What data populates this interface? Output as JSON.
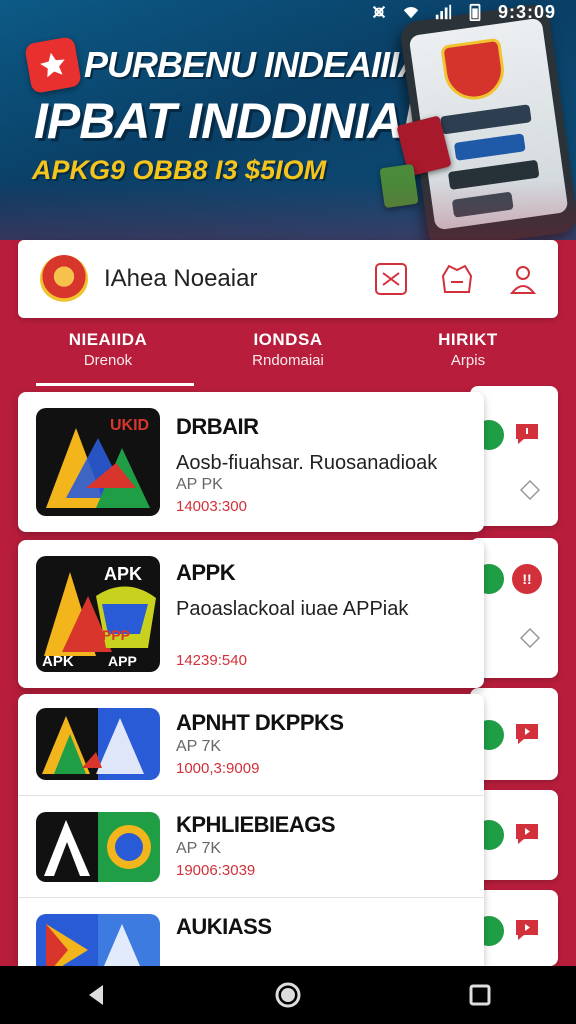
{
  "status_bar": {
    "time": "9:3:09"
  },
  "banner": {
    "title": "PURBENU INDEAIIIA",
    "subtitle": "IPBAT INDDINIAN",
    "tagline": "APKG9 OBB8 I3 $5IOM"
  },
  "header": {
    "title": "IAhea Noeaiar"
  },
  "tabs": [
    {
      "label": "NIEAIIDA",
      "sub": "Drenok"
    },
    {
      "label": "IONDSA",
      "sub": "Rndomaiai"
    },
    {
      "label": "HIRIKT",
      "sub": "Arpis"
    }
  ],
  "featured_apps": [
    {
      "name": "DRBAIR",
      "desc": "Aosb-fiuahsar. Ruosanadioak",
      "tag": "AP PK",
      "count": "14003:300"
    },
    {
      "name": "APPK",
      "desc": "Paoaslackoal iuae APPiak",
      "tag": "",
      "count": "14239:540"
    }
  ],
  "list_apps": [
    {
      "name": "APNHT DKPPKS",
      "tag": "AP 7K",
      "count": "1000,3:9009"
    },
    {
      "name": "KPHLIEBIEAGS",
      "tag": "AP 7K",
      "count": "19006:3039"
    },
    {
      "name": "AUKIASS",
      "tag": "",
      "count": ""
    }
  ],
  "icon_labels": {
    "app1": "UKID",
    "app2_top": "APK",
    "app2_bottom_left": "APK",
    "app2_bottom_right": "APP",
    "app2_mid": "PPP"
  },
  "colors": {
    "accent": "#d2303a",
    "banner": "#0a3f66",
    "tagline": "#f5c51b",
    "badge_green": "#1f9e46"
  }
}
